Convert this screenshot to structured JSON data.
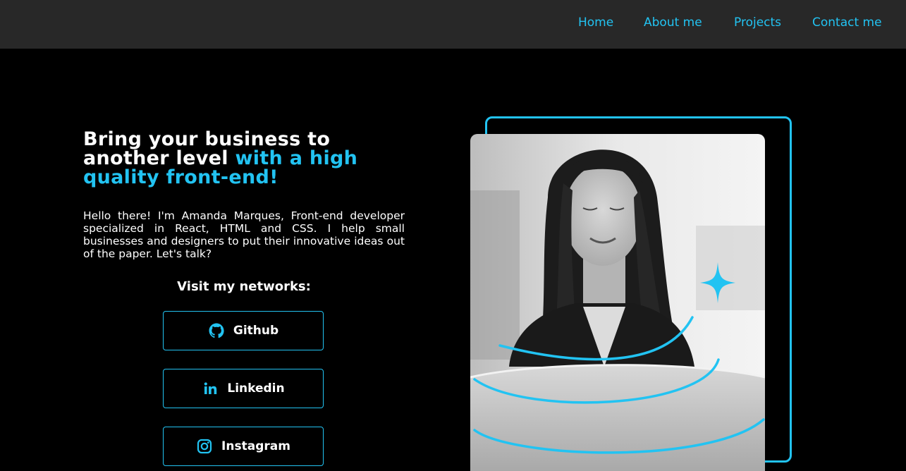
{
  "nav": {
    "home": "Home",
    "about": "About me",
    "projects": "Projects",
    "contact": "Contact me"
  },
  "hero": {
    "headline_white": "Bring your business to another level",
    "headline_accent": "with a high quality front-end!",
    "intro": "Hello there! I'm Amanda Marques, Front-end developer specialized in React, HTML and CSS. I help small businesses and designers to put their innovative ideas out of the paper. Let's talk?",
    "networks_title": "Visit my networks:",
    "networks": [
      {
        "label": "Github",
        "icon": "github-icon"
      },
      {
        "label": "Linkedin",
        "icon": "linkedin-icon"
      },
      {
        "label": "Instagram",
        "icon": "instagram-icon"
      }
    ]
  },
  "colors": {
    "accent": "#22c3f2",
    "navbar_bg": "#282828",
    "page_bg": "#000000",
    "text": "#ffffff"
  },
  "icons": [
    "github-icon",
    "linkedin-icon",
    "instagram-icon",
    "sparkle-icon"
  ]
}
